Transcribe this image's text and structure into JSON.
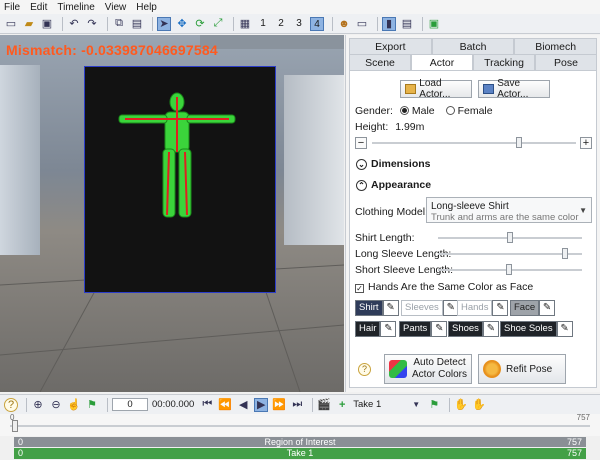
{
  "menu": [
    "File",
    "Edit",
    "Timeline",
    "View",
    "Help"
  ],
  "toolbar": {
    "view_numbers": [
      "1",
      "2",
      "3",
      "4"
    ],
    "active_view": "4"
  },
  "viewport": {
    "mismatch_text": "Mismatch: -0.033987046697584"
  },
  "panel": {
    "top_tabs": [
      "Export",
      "Batch",
      "Biomech"
    ],
    "bottom_tabs": [
      "Scene",
      "Actor",
      "Tracking",
      "Pose"
    ],
    "active_tab": "Actor",
    "load_actor": "Load Actor...",
    "save_actor": "Save Actor...",
    "gender_label": "Gender:",
    "gender_male": "Male",
    "gender_female": "Female",
    "height_label": "Height:",
    "height_value": "1.99m",
    "height_slider_fraction": 0.72,
    "dimensions_label": "Dimensions",
    "appearance_label": "Appearance",
    "clothing_model_label": "Clothing Model:",
    "clothing_model_value": "Long-sleeve Shirt",
    "clothing_model_sub": "Trunk and arms are the same color",
    "shirt_length_label": "Shirt Length:",
    "long_sleeve_label": "Long Sleeve Length:",
    "short_sleeve_label": "Short Sleeve Length:",
    "shirt_length_fraction": 0.5,
    "long_sleeve_fraction": 0.88,
    "short_sleeve_fraction": 0.49,
    "hands_same_color": "Hands Are the Same Color as Face",
    "colors_row1": [
      "Shirt",
      "Sleeves",
      "Hands",
      "Face"
    ],
    "colors_row2": [
      "Hair",
      "Pants",
      "Shoes",
      "Shoe Soles"
    ],
    "auto_detect": "Auto Detect Actor Colors",
    "auto_detect_line1": "Auto Detect",
    "auto_detect_line2": "Actor Colors",
    "refit_pose": "Refit Pose"
  },
  "timeline": {
    "frame": "0",
    "time": "00:00.000",
    "take_select": "Take 1",
    "range_start": "0",
    "range_end": "757",
    "roi_label": "Region of Interest",
    "roi_start": "0",
    "roi_end": "757",
    "take_label": "Take 1",
    "take_start": "0",
    "take_end": "757"
  }
}
